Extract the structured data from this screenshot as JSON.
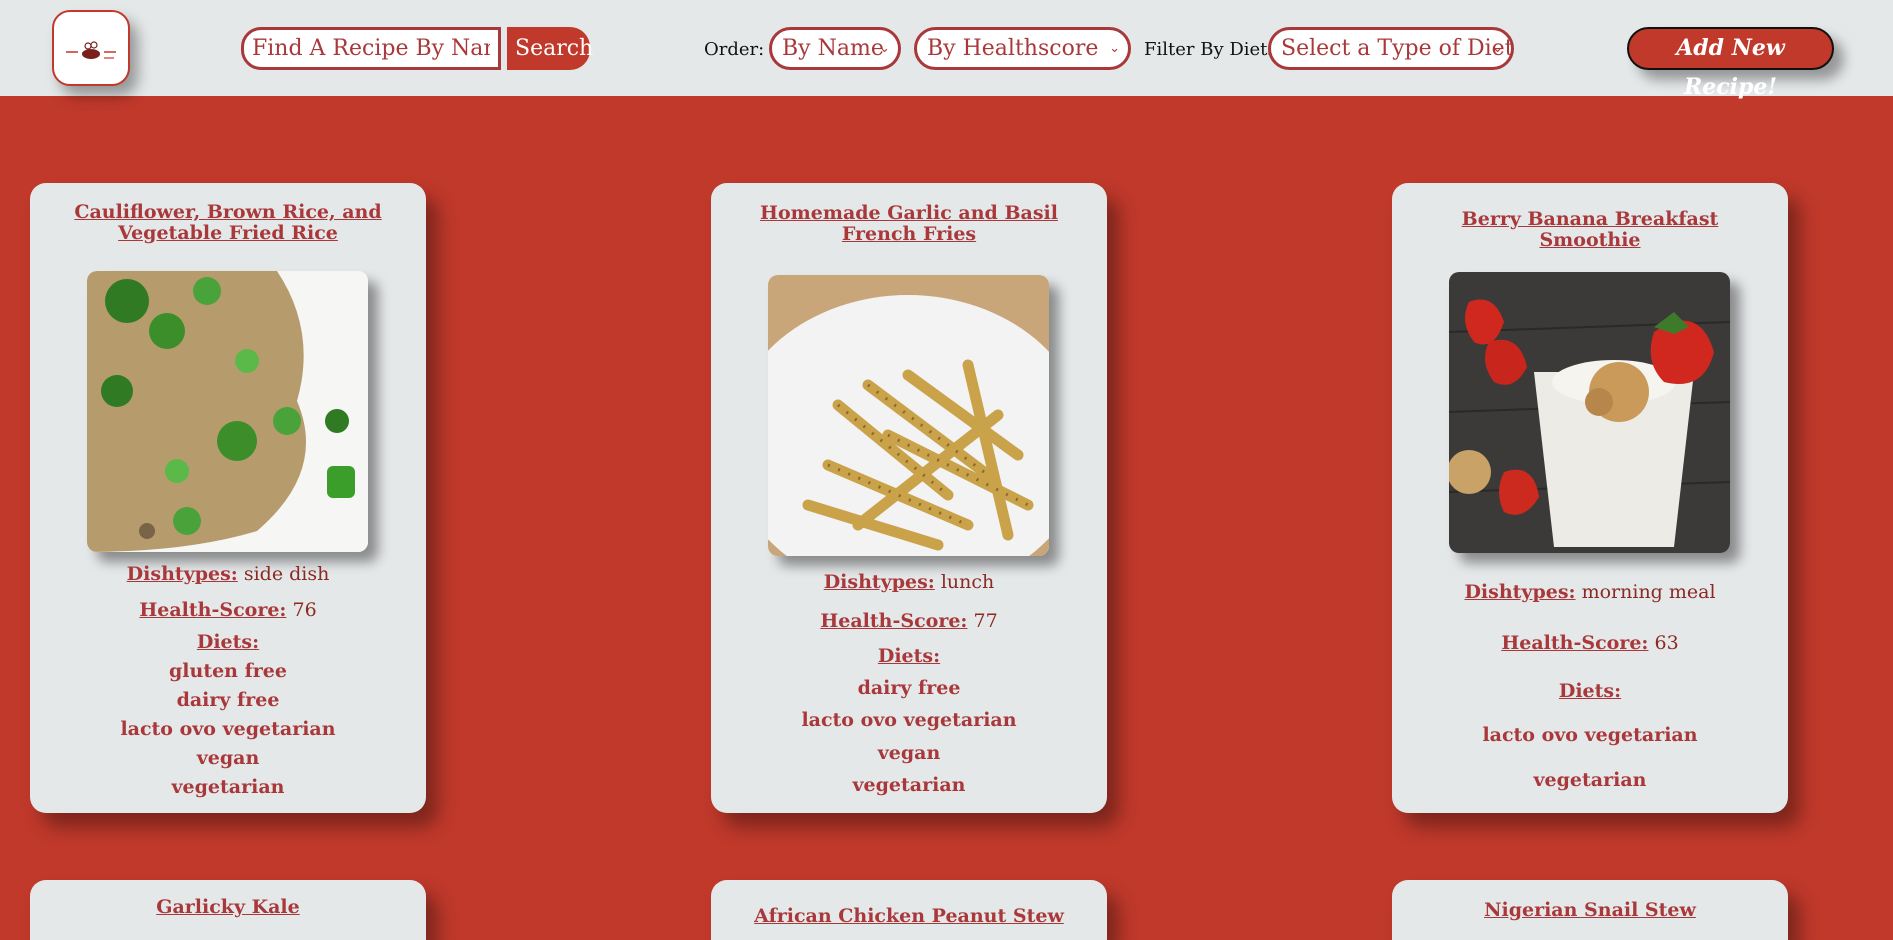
{
  "nav": {
    "search_placeholder": "Find A Recipe By Name...",
    "search_button": "Search",
    "order_label": "Order:",
    "order_name_value": "By Name",
    "order_health_value": "By Healthscore",
    "filter_label": "Filter By Diets:",
    "diet_select_value": "Select a Type of Diet",
    "add_button": "Add New Recipe!"
  },
  "labels": {
    "dishtypes": "Dishtypes:",
    "health": "Health-Score:",
    "diets": "Diets:"
  },
  "cards": [
    {
      "title": "Cauliflower, Brown Rice, and Vegetable Fried Rice",
      "dishtype": "side dish",
      "health": "76",
      "diets": [
        "gluten free",
        "dairy free",
        "lacto ovo vegetarian",
        "vegan",
        "vegetarian"
      ]
    },
    {
      "title": "Homemade Garlic and Basil French Fries",
      "dishtype": "lunch",
      "health": "77",
      "diets": [
        "dairy free",
        "lacto ovo vegetarian",
        "vegan",
        "vegetarian"
      ]
    },
    {
      "title": "Berry Banana Breakfast Smoothie",
      "dishtype": "morning meal",
      "health": "63",
      "diets": [
        "lacto ovo vegetarian",
        "vegetarian"
      ]
    },
    {
      "title": "Garlicky Kale"
    },
    {
      "title": "African Chicken Peanut Stew"
    },
    {
      "title": "Nigerian Snail Stew"
    }
  ],
  "icons": {
    "logo": "recipe-logo-icon",
    "chevron": "chevron-down-icon"
  },
  "colors": {
    "accent": "#c0392b",
    "navbar": "#e5e8e9",
    "card": "#e5e8e9"
  }
}
